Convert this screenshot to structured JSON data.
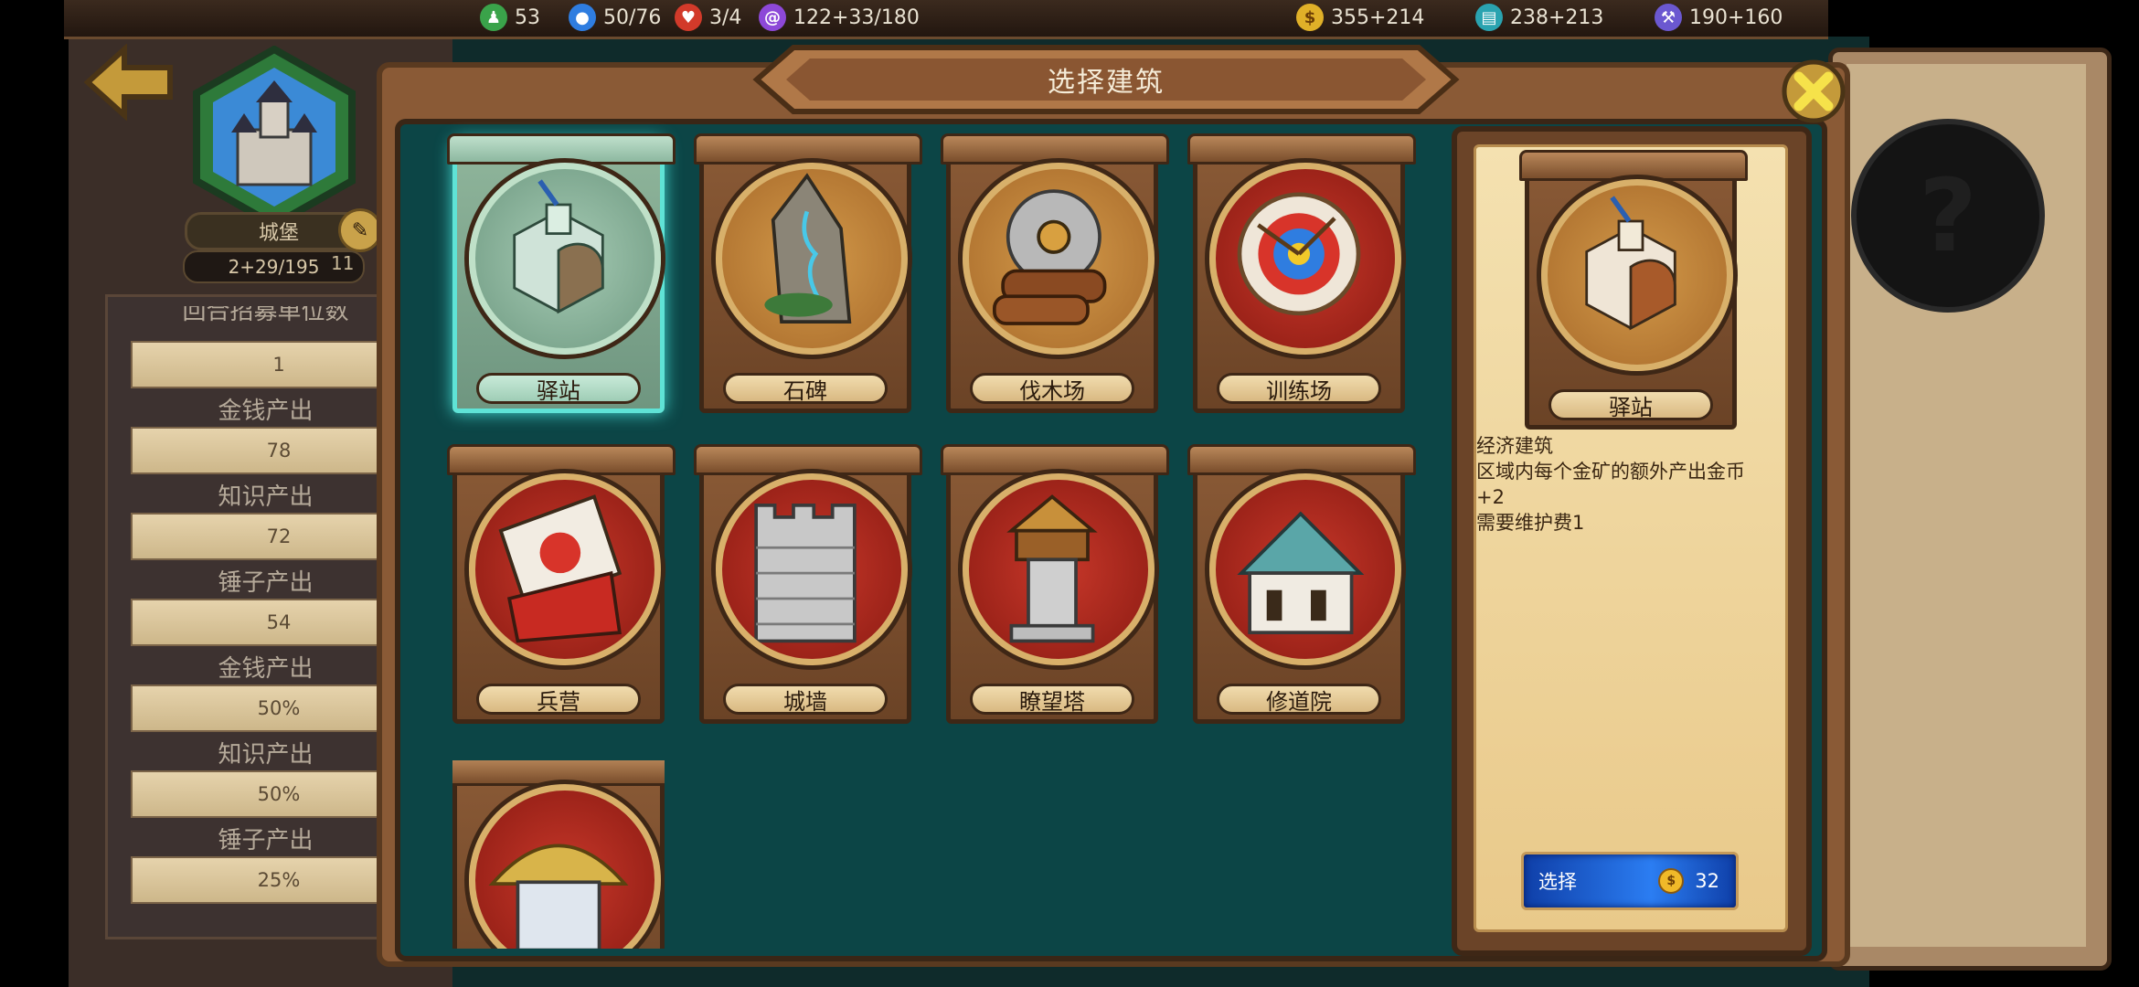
{
  "resources": [
    {
      "icon": "population-icon",
      "value": "53",
      "color": "#3aa34a"
    },
    {
      "icon": "person-icon",
      "value": "50/76",
      "color": "#2f7de0"
    },
    {
      "icon": "heart-icon",
      "value": "3/4",
      "color": "#d23a2a"
    },
    {
      "icon": "swirl-icon",
      "value": "122+33/180",
      "color": "#8d48d8"
    },
    {
      "icon": "gold-coin-icon",
      "value": "355+214",
      "color": "#e0b028"
    },
    {
      "icon": "book-icon",
      "value": "238+213",
      "color": "#2aa3b0"
    },
    {
      "icon": "hammer-icon",
      "value": "190+160",
      "color": "#6b58d0"
    }
  ],
  "city": {
    "name": "城堡",
    "population": "2+29/195",
    "population_extra": "11"
  },
  "stats": [
    {
      "label": "回合招募单位数",
      "value": "1"
    },
    {
      "label": "金钱产出",
      "value": "78"
    },
    {
      "label": "知识产出",
      "value": "72"
    },
    {
      "label": "锤子产出",
      "value": "54"
    },
    {
      "label": "金钱产出",
      "value": "50%"
    },
    {
      "label": "知识产出",
      "value": "50%"
    },
    {
      "label": "锤子产出",
      "value": "25%"
    }
  ],
  "dialog": {
    "title": "选择建筑"
  },
  "buildings": [
    {
      "label": "驿站",
      "icon": "post-station-icon",
      "selected": true
    },
    {
      "label": "石碑",
      "icon": "stone-monument-icon"
    },
    {
      "label": "伐木场",
      "icon": "lumber-mill-icon"
    },
    {
      "label": "训练场",
      "icon": "training-ground-icon"
    },
    {
      "label": "兵营",
      "icon": "barracks-icon"
    },
    {
      "label": "城墙",
      "icon": "city-wall-icon"
    },
    {
      "label": "瞭望塔",
      "icon": "watchtower-icon"
    },
    {
      "label": "修道院",
      "icon": "monastery-icon"
    },
    {
      "label": "",
      "icon": "hut-icon"
    }
  ],
  "detail": {
    "name": "驿站",
    "type": "经济建筑",
    "effect": "区域内每个金矿的额外产出金币 +2",
    "upkeep": "需要维护费1",
    "select_label": "选择",
    "cost": "32"
  },
  "mystery": {
    "symbol": "?"
  }
}
